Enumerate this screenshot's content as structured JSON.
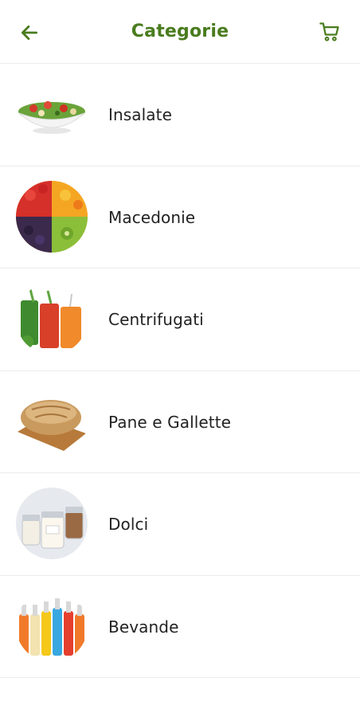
{
  "header": {
    "title": "Categorie",
    "back_icon": "arrow-left-icon",
    "cart_icon": "cart-icon",
    "accent_color": "#4a7c1f"
  },
  "categories": [
    {
      "label": "Insalate",
      "image": "salad-bowl"
    },
    {
      "label": "Macedonie",
      "image": "fruit-salad"
    },
    {
      "label": "Centrifugati",
      "image": "juices"
    },
    {
      "label": "Pane e Gallette",
      "image": "bread-loaf"
    },
    {
      "label": "Dolci",
      "image": "jars"
    },
    {
      "label": "Bevande",
      "image": "bottles"
    }
  ]
}
